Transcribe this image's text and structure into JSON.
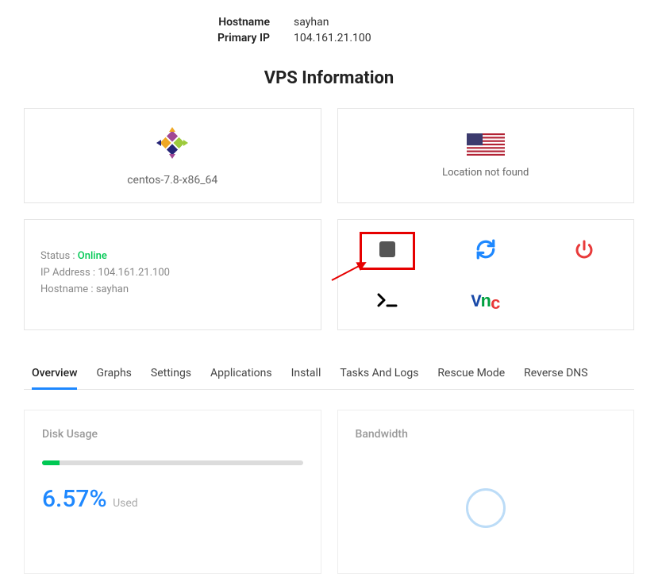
{
  "header": {
    "hostname_label": "Hostname",
    "hostname_value": "sayhan",
    "ip_label": "Primary IP",
    "ip_value": "104.161.21.100"
  },
  "section_title": "VPS Information",
  "os": {
    "name": "centos-7.8-x86_64"
  },
  "location": {
    "text": "Location not found"
  },
  "status": {
    "status_label": "Status :",
    "status_value": "Online",
    "ip_label": "IP Address :",
    "ip_value": "104.161.21.100",
    "hostname_label": "Hostname :",
    "hostname_value": "sayhan"
  },
  "tabs": {
    "items": [
      "Overview",
      "Graphs",
      "Settings",
      "Applications",
      "Install",
      "Tasks And Logs",
      "Rescue Mode",
      "Reverse DNS"
    ],
    "active_index": 0
  },
  "disk_usage": {
    "title": "Disk Usage",
    "percent": 6.57,
    "percent_text": "6.57%",
    "unit": "Used"
  },
  "bandwidth": {
    "title": "Bandwidth"
  },
  "colors": {
    "primary": "#1e88ff",
    "success": "#00c853",
    "danger": "#e83a3a"
  }
}
